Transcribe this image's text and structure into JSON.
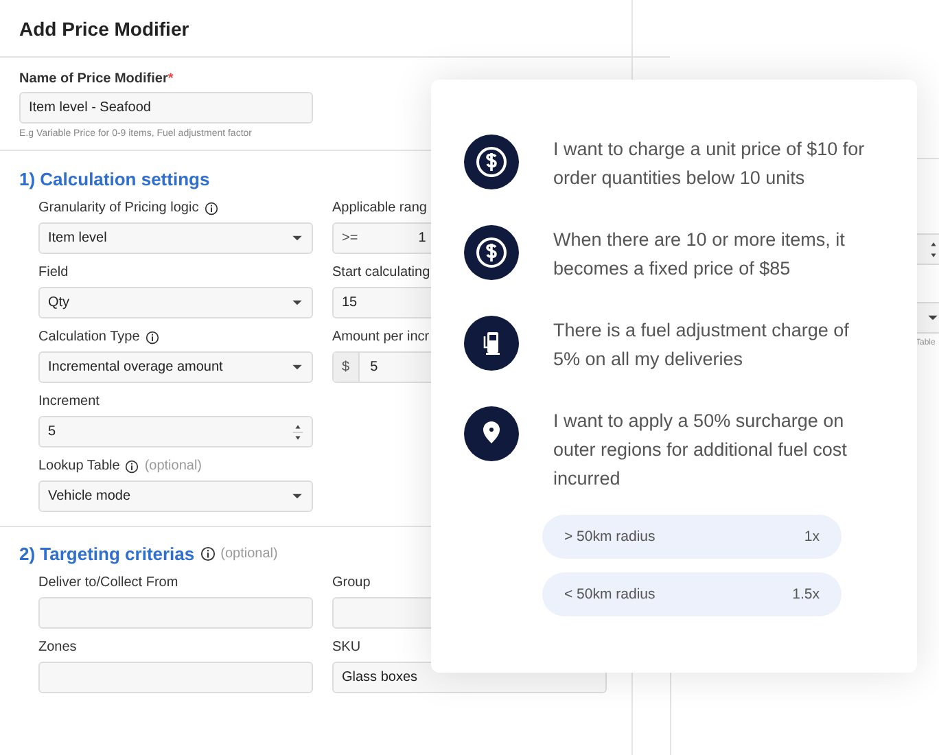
{
  "window": {
    "title": "Add Price Modifier"
  },
  "name_field": {
    "label": "Name of Price Modifier",
    "required_mark": "*",
    "value": "Item level - Seafood",
    "hint": "E.g Variable Price for 0-9 items, Fuel adjustment factor"
  },
  "calculation": {
    "title": "1) Calculation settings",
    "left": [
      {
        "kind": "select",
        "label": "Granularity of Pricing logic",
        "info": true,
        "value": "Item level"
      },
      {
        "kind": "select",
        "label": "Field",
        "info": false,
        "value": "Qty"
      },
      {
        "kind": "select",
        "label": "Calculation Type",
        "info": true,
        "value": "Incremental overage amount"
      },
      {
        "kind": "number",
        "label": "Increment",
        "info": false,
        "value": "5"
      },
      {
        "kind": "select",
        "label": "Lookup Table",
        "info": true,
        "optional": "(optional)",
        "value": "Vehicle mode"
      }
    ],
    "right": [
      {
        "kind": "range",
        "label": "Applicable rang",
        "prefix": ">=",
        "value": "1"
      },
      {
        "kind": "text",
        "label": "Start calculating",
        "value": "15"
      },
      {
        "kind": "money",
        "label": "Amount per incr",
        "prefix": "$",
        "value": "5"
      }
    ]
  },
  "targeting": {
    "title": "2) Targeting criterias",
    "optional": "(optional)",
    "fields": [
      {
        "label": "Deliver to/Collect From"
      },
      {
        "label": "Group"
      },
      {
        "label": "Zones"
      },
      {
        "label": "SKU",
        "value": "Glass boxes"
      }
    ]
  },
  "side_panel": {
    "hint": "Table"
  },
  "examples": [
    {
      "kind": "dollar",
      "text": "I want to charge a unit price of $10 for order quantities below 10 units"
    },
    {
      "kind": "dollar",
      "text": "When there are 10 or more items, it becomes a fixed price of $85"
    },
    {
      "kind": "fuel",
      "text": "There is a fuel adjustment charge of 5% on all my deliveries"
    },
    {
      "kind": "pin",
      "text": "I want to apply a 50% surcharge on outer regions for additional fuel cost incurred",
      "tiers": [
        {
          "label": "> 50km radius",
          "factor": "1x"
        },
        {
          "label": "< 50km radius",
          "factor": "1.5x"
        }
      ]
    }
  ]
}
